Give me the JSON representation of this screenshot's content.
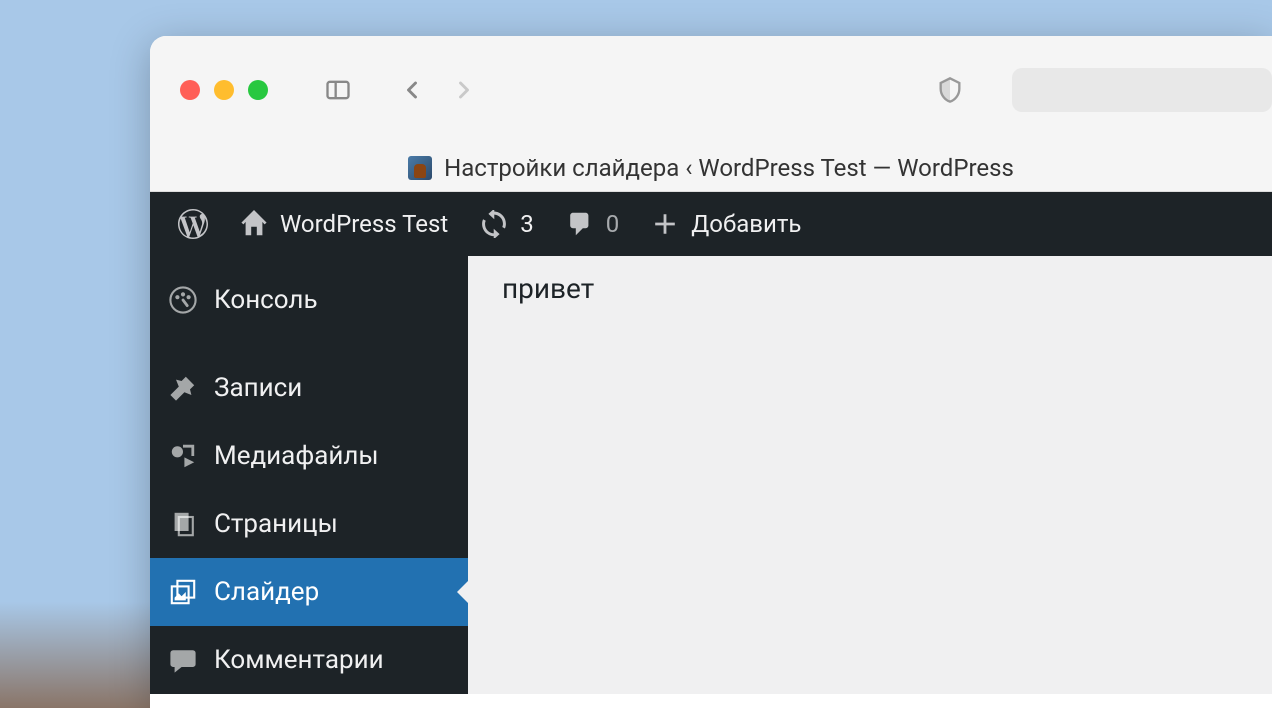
{
  "tab": {
    "title": "Настройки слайдера ‹ WordPress Test — WordPress"
  },
  "admin_bar": {
    "site_name": "WordPress Test",
    "updates_count": "3",
    "comments_count": "0",
    "add_new_label": "Добавить"
  },
  "sidebar": {
    "items": [
      {
        "label": "Консоль"
      },
      {
        "label": "Записи"
      },
      {
        "label": "Медиафайлы"
      },
      {
        "label": "Страницы"
      },
      {
        "label": "Слайдер"
      },
      {
        "label": "Комментарии"
      }
    ]
  },
  "main": {
    "content": "привет"
  }
}
